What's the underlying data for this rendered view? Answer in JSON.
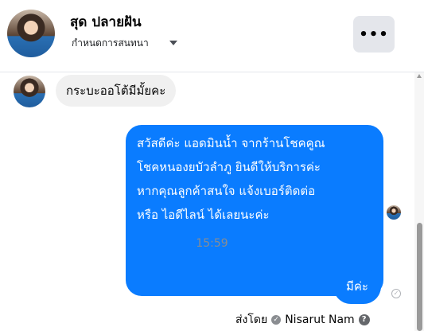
{
  "header": {
    "name": "สุด ปลายฝัน",
    "subtitle": "กำหนดการสนทนา",
    "more_label": "•••"
  },
  "messages": {
    "incoming_1": "กระบะออโต้มีมั้ยคะ",
    "outgoing_lines": [
      "สวัสดีค่ะ แอดมินน้ำ จากร้านโชคคูณ",
      "โชคหนองยบัวลำภู ยินดีให้บริการค่ะ",
      "หากคุณลูกค้าสนใจ แจ้งเบอร์ติดต่อ",
      "หรือ ไอดีไลน์ ได้เลยนะค่ะ"
    ],
    "timestamp": "15:59",
    "outgoing_2": "มีค่ะ"
  },
  "sent_by": {
    "prefix": "ส่งโดย",
    "name": "Nisarut Nam",
    "help_glyph": "?"
  },
  "colors": {
    "accent": "#0a7cff",
    "incoming_bg": "#f0f0f0",
    "muted": "#8a8d91"
  }
}
